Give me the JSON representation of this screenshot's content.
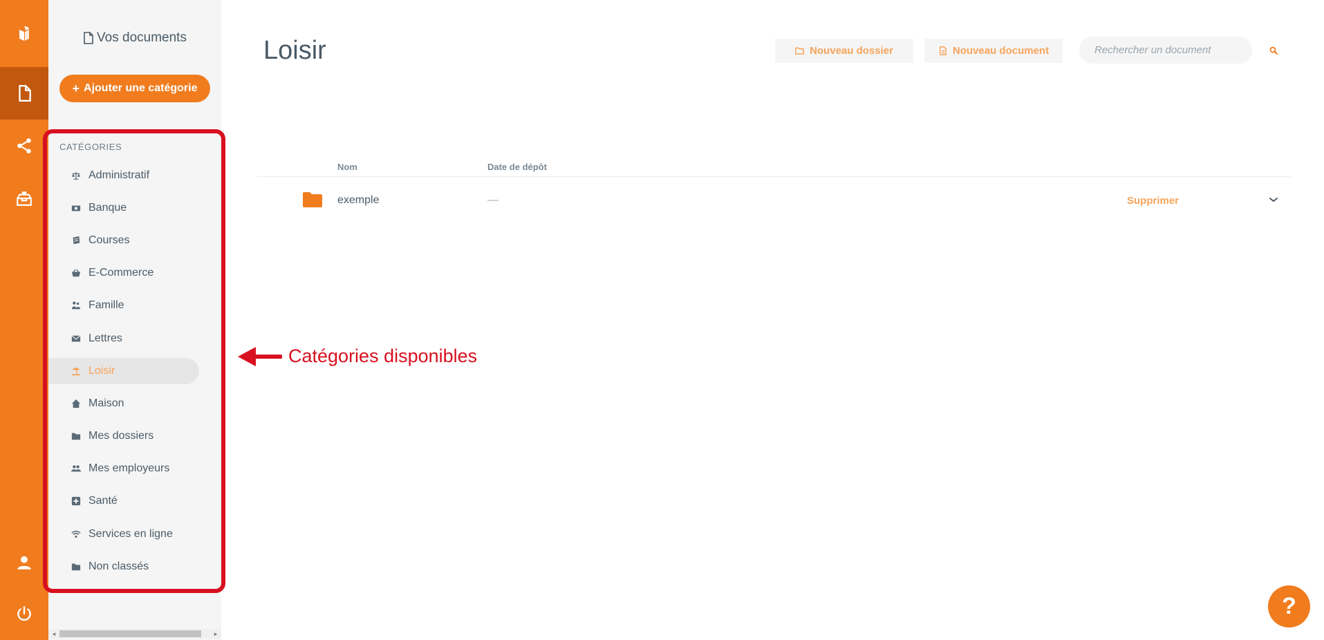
{
  "sidebar": {
    "title": "Vos documents",
    "add_category_label": "Ajouter une catégorie",
    "categories_header": "CATÉGORIES",
    "items": [
      {
        "label": "Administratif",
        "icon": "scale-icon"
      },
      {
        "label": "Banque",
        "icon": "money-icon"
      },
      {
        "label": "Courses",
        "icon": "receipt-icon"
      },
      {
        "label": "E-Commerce",
        "icon": "basket-icon"
      },
      {
        "label": "Famille",
        "icon": "family-icon"
      },
      {
        "label": "Lettres",
        "icon": "envelope-icon"
      },
      {
        "label": "Loisir",
        "icon": "beach-icon",
        "active": true
      },
      {
        "label": "Maison",
        "icon": "home-icon"
      },
      {
        "label": "Mes dossiers",
        "icon": "folder-icon"
      },
      {
        "label": "Mes employeurs",
        "icon": "people-icon"
      },
      {
        "label": "Santé",
        "icon": "health-icon"
      },
      {
        "label": "Services en ligne",
        "icon": "wifi-icon"
      },
      {
        "label": "Non classés",
        "icon": "folder-icon"
      }
    ]
  },
  "annotation": {
    "text": "Catégories disponibles"
  },
  "main": {
    "title": "Loisir",
    "new_folder_label": "Nouveau dossier",
    "new_document_label": "Nouveau document",
    "search_placeholder": "Rechercher un document",
    "columns": {
      "name": "Nom",
      "date": "Date de dépôt"
    },
    "rows": [
      {
        "name": "exemple",
        "date": "—",
        "action": "Supprimer"
      }
    ]
  },
  "help_label": "?",
  "colors": {
    "accent": "#f07c1e",
    "accent_dark": "#c2580e",
    "accent_light": "#f6a45a",
    "annotation": "#d8101f"
  }
}
